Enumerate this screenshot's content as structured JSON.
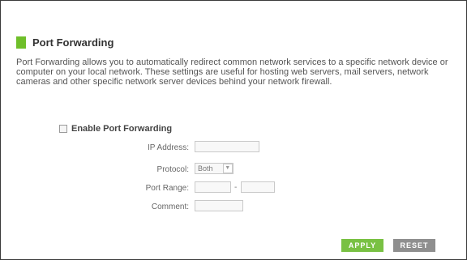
{
  "section": {
    "title": "Port Forwarding",
    "description": "Port Forwarding allows you to automatically redirect common network services to a specific network device or computer on your local network. These settings are useful for hosting web servers, mail servers, network cameras and other specific network server devices behind your network firewall."
  },
  "form": {
    "enable_label": "Enable Port Forwarding",
    "enable_checked": false,
    "ip_label": "IP Address:",
    "ip_value": "",
    "protocol_label": "Protocol:",
    "protocol_value": "Both",
    "port_range_label": "Port Range:",
    "port_start_value": "",
    "port_end_value": "",
    "port_separator": "-",
    "comment_label": "Comment:",
    "comment_value": ""
  },
  "buttons": {
    "apply_label": "APPLY",
    "reset_label": "RESET"
  },
  "colors": {
    "accent_green": "#6fbf2a",
    "apply_green": "#79c143",
    "reset_gray": "#8f8f8f"
  },
  "icons": {
    "protocol_dropdown": "chevron-down-icon",
    "section_marker": "green-block-icon"
  }
}
